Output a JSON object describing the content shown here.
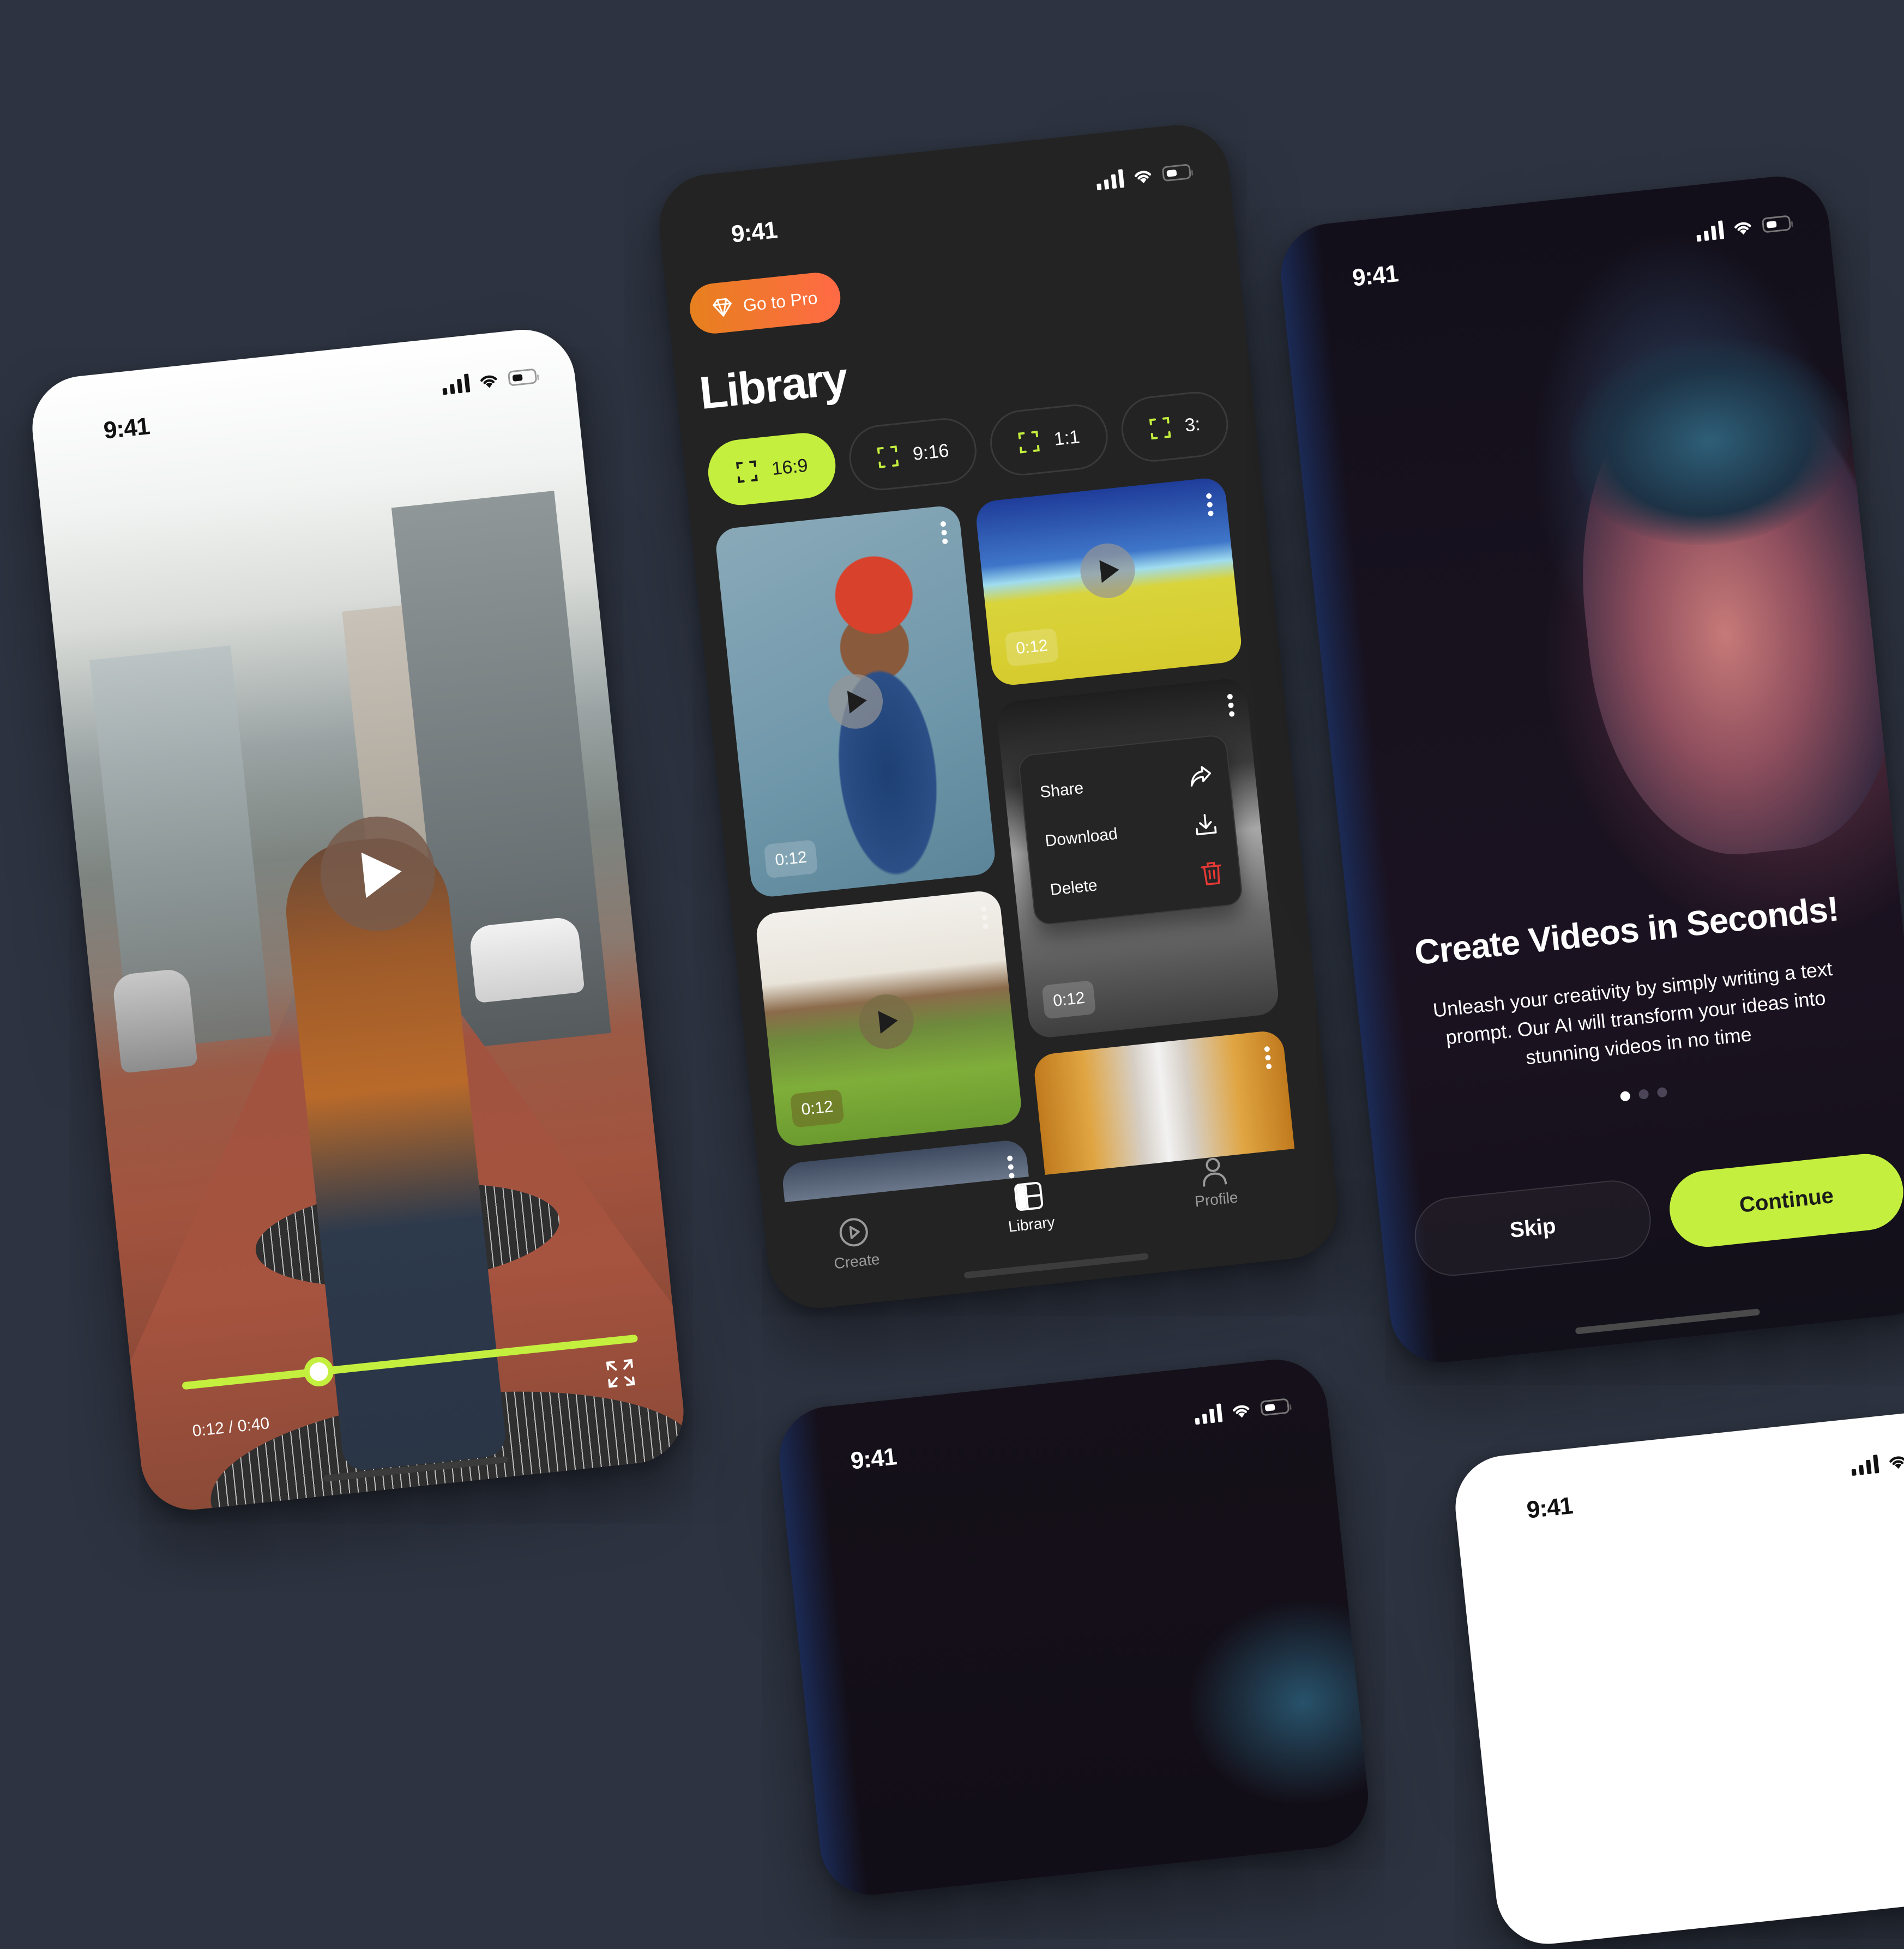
{
  "colors": {
    "background": "#2d3340",
    "accent": "#c4ef3e",
    "pro_gradient_start": "#e7801e",
    "pro_gradient_end": "#ff6a45",
    "danger": "#e53935",
    "surface": "#232323"
  },
  "status_bar": {
    "time": "9:41",
    "icons": [
      "signal-icon",
      "wifi-icon",
      "battery-icon"
    ]
  },
  "player": {
    "current_time": "0:12",
    "total_time": "0:40",
    "time_label": "0:12 / 0:40",
    "progress": 0.3,
    "icons": [
      "play-icon",
      "fullscreen-icon"
    ]
  },
  "library": {
    "pro_button": "Go to Pro",
    "title": "Library",
    "aspect_chips": [
      {
        "label": "16:9",
        "active": true
      },
      {
        "label": "9:16",
        "active": false
      },
      {
        "label": "1:1",
        "active": false
      },
      {
        "label": "3:",
        "active": false
      }
    ],
    "videos": [
      {
        "subject": "woman-red-hair",
        "duration": "0:12"
      },
      {
        "subject": "yellow-roofs",
        "duration": "0:12"
      },
      {
        "subject": "bw-window-person",
        "duration": "0:12"
      },
      {
        "subject": "father-child-field",
        "duration": "0:12"
      },
      {
        "subject": "glass-buildings",
        "duration": ""
      },
      {
        "subject": "mountain-clouds",
        "duration": ""
      }
    ],
    "context_menu": [
      {
        "label": "Share",
        "icon": "share-icon"
      },
      {
        "label": "Download",
        "icon": "download-icon"
      },
      {
        "label": "Delete",
        "icon": "trash-icon"
      }
    ],
    "tabs": [
      {
        "label": "Create",
        "icon": "play-circle-icon",
        "active": false
      },
      {
        "label": "Library",
        "icon": "library-grid-icon",
        "active": true
      },
      {
        "label": "Profile",
        "icon": "user-icon",
        "active": false
      }
    ]
  },
  "onboarding": {
    "title": "Create Videos in Seconds!",
    "body": "Unleash your creativity by simply writing a text prompt. Our AI will transform your ideas into stunning videos in no time",
    "page_count": 3,
    "current_page": 1,
    "skip_label": "Skip",
    "continue_label": "Continue"
  }
}
